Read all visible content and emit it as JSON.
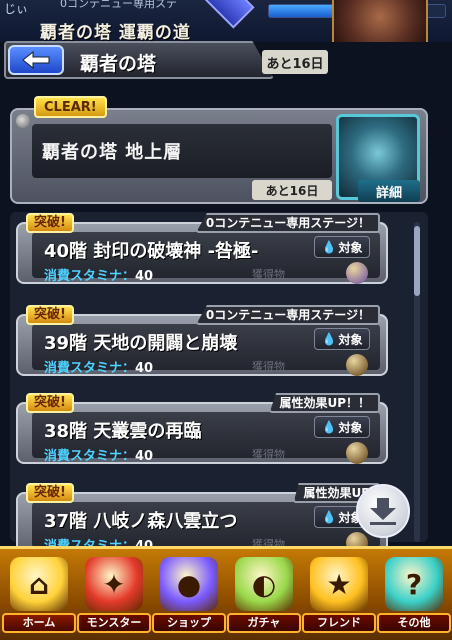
{
  "top": {
    "user_name": "じぃ",
    "banner_title": "覇者の塔 運覇の道",
    "stage_name": "0コンテニュー専用ステ",
    "gauge_fraction": 0.55
  },
  "header": {
    "title": "覇者の塔",
    "days_left": "あと16日"
  },
  "feature": {
    "clear_label": "CLEAR!",
    "name": "覇者の塔 地上層",
    "days_left": "あと16日",
    "detail_label": "詳細"
  },
  "stages": [
    {
      "badge": "突破!",
      "tag": "0コンテニュー専用ステージ！",
      "title": "40階 封印の破壊神 -咎極-",
      "target_label": "対象",
      "stamina_label": "消費スタミナ：",
      "stamina_value": "40",
      "reward_label": "獲得物",
      "orb_color": "#6a4aa0"
    },
    {
      "badge": "突破!",
      "tag": "0コンテニュー専用ステージ！",
      "title": "39階 天地の開闢と崩壊",
      "target_label": "対象",
      "stamina_label": "消費スタミナ：",
      "stamina_value": "40",
      "reward_label": "獲得物",
      "orb_color": "#5a3a10"
    },
    {
      "badge": "突破!",
      "tag": "属性効果UP！！",
      "title": "38階 天叢雲の再臨",
      "target_label": "対象",
      "stamina_label": "消費スタミナ：",
      "stamina_value": "40",
      "reward_label": "獲得物",
      "orb_color": "#5a3a10"
    },
    {
      "badge": "突破!",
      "tag": "属性効果UP",
      "title": "37階 八岐ノ森八雲立つ",
      "target_label": "対象",
      "stamina_label": "消費スタミナ：",
      "stamina_value": "40",
      "reward_label": "獲得物",
      "orb_color": "#5a3a10"
    }
  ],
  "nav": [
    {
      "label": "ホーム",
      "icon": "home-icon",
      "color": "#ffd23a"
    },
    {
      "label": "モンスター",
      "icon": "monster-icon",
      "color": "#e33a2a"
    },
    {
      "label": "ショップ",
      "icon": "orb-icon",
      "color": "#7a5aff"
    },
    {
      "label": "ガチャ",
      "icon": "egg-icon",
      "color": "#9ad84a"
    },
    {
      "label": "フレンド",
      "icon": "friend-icon",
      "color": "#ffc020"
    },
    {
      "label": "その他",
      "icon": "other-icon",
      "color": "#3ad0c8"
    }
  ]
}
